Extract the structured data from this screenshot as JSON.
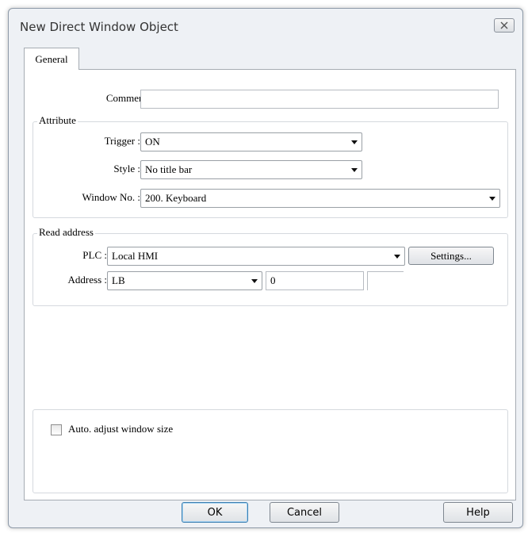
{
  "window": {
    "title": "New Direct Window Object"
  },
  "tabs": [
    {
      "label": "General"
    }
  ],
  "comment": {
    "label": "Comment :",
    "value": ""
  },
  "attribute": {
    "title": "Attribute",
    "trigger": {
      "label": "Trigger :",
      "value": "ON"
    },
    "style": {
      "label": "Style :",
      "value": "No title bar"
    },
    "window_no": {
      "label": "Window No. :",
      "value": "200. Keyboard"
    }
  },
  "read_address": {
    "title": "Read address",
    "plc": {
      "label": "PLC :",
      "value": "Local HMI"
    },
    "settings_label": "Settings...",
    "address": {
      "label": "Address :",
      "device": "LB",
      "value": "0"
    }
  },
  "auto_adjust": {
    "label": "Auto. adjust window size",
    "checked": false
  },
  "footer": {
    "ok_label": "OK",
    "cancel_label": "Cancel",
    "help_label": "Help"
  }
}
